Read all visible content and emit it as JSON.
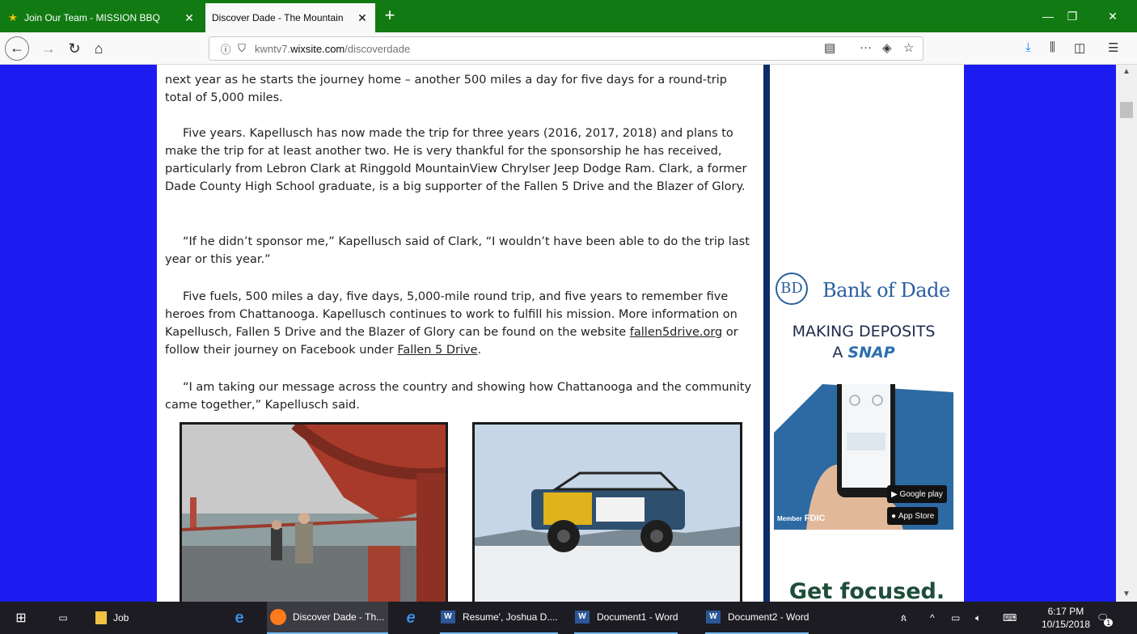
{
  "browser": {
    "tabs": [
      {
        "title": "Join Our Team - MISSION BBQ",
        "active": false
      },
      {
        "title": "Discover Dade - The Mountain",
        "active": true
      }
    ],
    "url_prefix": "kwntv7.",
    "url_domain": "wixsite.com",
    "url_path": "/discoverdade"
  },
  "article": {
    "p1": "next year as he starts the journey home – another 500 miles a day for five days for a round-trip total of 5,000 miles.",
    "p2": "Five years. Kapellusch has now made the trip for three years (2016, 2017, 2018) and plans to make the trip for at least another two. He is very thankful for the sponsorship he has received, particularly from Lebron Clark at Ringgold MountainView Chrylser Jeep Dodge Ram. Clark, a former Dade County High School graduate, is a big supporter of the Fallen 5 Drive and the Blazer of Glory.",
    "p3": "“If he didn’t sponsor me,” Kapellusch said of Clark, “I wouldn’t have been able to do the trip last year or this year.”",
    "p4_text": "Five fuels, 500 miles a day, five days, 5,000-mile round trip, and five years to remember five heroes from Chattanooga. Kapellusch continues to work to fulfill his mission. More information on Kapellusch, Fallen 5 Drive and the Blazer of Glory can be found on the website ",
    "p4_link1": "fallen5drive.org",
    "p4_mid": " or follow their journey on Facebook under ",
    "p4_link2": "Fallen 5 Drive",
    "p4_end": ".",
    "p5": "“I am taking our message across the country and showing how Chattanooga and the community came together,” Kapellusch said."
  },
  "ad": {
    "logo_letters": "BD",
    "brand": "Bank of Dade",
    "line1": "MAKING DEPOSITS",
    "line2_prefix": "A ",
    "line2_emph": "SNAP",
    "google_play": "Google play",
    "app_store": "App Store",
    "fdic": "FDIC",
    "fdic_member": "Member"
  },
  "sidebar_bottom": "Get focused.",
  "taskbar": {
    "items": [
      "Job",
      "Discover Dade - Th...",
      "Resume', Joshua D....",
      "Document1 - Word",
      "Document2 - Word"
    ],
    "time": "6:17 PM",
    "date": "10/15/2018",
    "notif_count": "1"
  }
}
